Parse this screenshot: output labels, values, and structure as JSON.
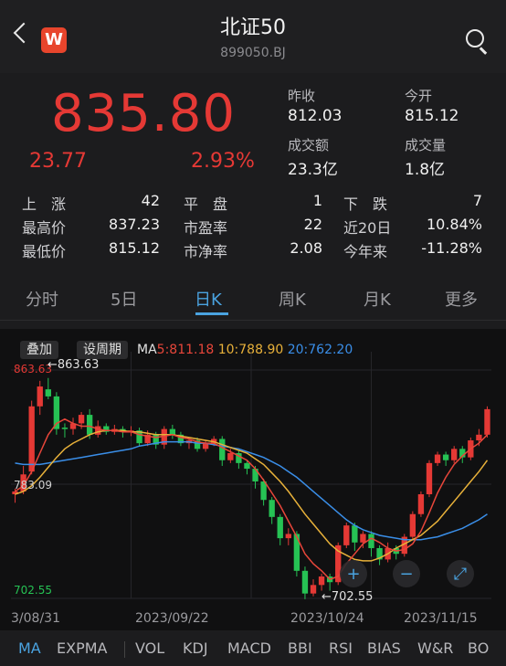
{
  "header": {
    "title": "北证50",
    "code": "899050.BJ",
    "logo": "W"
  },
  "quote": {
    "price": "835.80",
    "change": "23.77",
    "change_pct": "2.93%",
    "prev_close_label": "昨收",
    "prev_close": "812.03",
    "open_label": "今开",
    "open": "815.12",
    "turnover_label": "成交额",
    "turnover": "23.3亿",
    "volume_label": "成交量",
    "volume": "1.8亿",
    "rise_label": "上　涨",
    "rise": "42",
    "flat_label": "平　盘",
    "flat": "1",
    "fall_label": "下　跌",
    "fall": "7",
    "high_label": "最高价",
    "high": "837.23",
    "pe_label": "市盈率",
    "pe": "22",
    "d20_label": "近20日",
    "d20": "10.84%",
    "low_label": "最低价",
    "low": "815.12",
    "pb_label": "市净率",
    "pb": "2.08",
    "ytd_label": "今年来",
    "ytd": "-11.28%"
  },
  "tabs": [
    "分时",
    "5日",
    "日K",
    "周K",
    "月K",
    "更多"
  ],
  "active_tab": "日K",
  "chart_toolbar": {
    "overlay": "叠加",
    "period": "设周期",
    "ma_prefix": "MA",
    "ma5": "5:811.18",
    "ma10": "10:788.90",
    "ma20": "20:762.20"
  },
  "chart_data": {
    "type": "candlestick",
    "y_top_label": "863.63",
    "y_mid_label": "783.09",
    "y_bot_label": "702.55",
    "max_marker": "863.63",
    "min_marker": "702.55",
    "ylim": [
      702.55,
      863.63
    ],
    "x_labels": [
      "3/08/31",
      "2023/09/22",
      "2023/10/24",
      "2023/11/15"
    ],
    "colors": {
      "up": "#e53935",
      "down": "#26c254",
      "ma5": "#e8463a",
      "ma10": "#e8b13a",
      "ma20": "#3a8ee8"
    },
    "candles": [
      [
        776,
        778,
        770,
        780
      ],
      [
        778,
        790,
        776,
        796
      ],
      [
        792,
        838,
        790,
        842
      ],
      [
        838,
        852,
        832,
        856
      ],
      [
        850,
        845,
        843,
        858
      ],
      [
        845,
        822,
        818,
        848
      ],
      [
        823,
        822,
        816,
        826
      ],
      [
        822,
        826,
        818,
        830
      ],
      [
        826,
        832,
        822,
        834
      ],
      [
        832,
        818,
        815,
        836
      ],
      [
        818,
        824,
        816,
        828
      ],
      [
        824,
        820,
        818,
        826
      ],
      [
        820,
        822,
        818,
        825
      ],
      [
        822,
        820,
        816,
        824
      ],
      [
        820,
        821,
        817,
        824
      ],
      [
        821,
        812,
        810,
        823
      ],
      [
        812,
        818,
        810,
        821
      ],
      [
        818,
        811,
        808,
        820
      ],
      [
        811,
        822,
        808,
        824
      ],
      [
        822,
        818,
        815,
        825
      ],
      [
        818,
        812,
        810,
        820
      ],
      [
        812,
        814,
        808,
        816
      ],
      [
        814,
        808,
        806,
        816
      ],
      [
        808,
        812,
        806,
        814
      ],
      [
        812,
        815,
        810,
        817
      ],
      [
        815,
        800,
        796,
        817
      ],
      [
        800,
        805,
        798,
        808
      ],
      [
        805,
        798,
        794,
        807
      ],
      [
        798,
        794,
        790,
        800
      ],
      [
        794,
        785,
        780,
        796
      ],
      [
        785,
        772,
        768,
        787
      ],
      [
        772,
        760,
        755,
        774
      ],
      [
        760,
        745,
        740,
        762
      ],
      [
        745,
        748,
        740,
        752
      ],
      [
        748,
        722,
        718,
        750
      ],
      [
        722,
        706,
        702,
        725
      ],
      [
        706,
        712,
        704,
        716
      ],
      [
        712,
        718,
        708,
        720
      ],
      [
        718,
        714,
        708,
        720
      ],
      [
        714,
        740,
        712,
        742
      ],
      [
        740,
        754,
        738,
        756
      ],
      [
        754,
        742,
        736,
        756
      ],
      [
        742,
        748,
        738,
        750
      ],
      [
        748,
        738,
        732,
        750
      ],
      [
        738,
        730,
        726,
        740
      ],
      [
        730,
        738,
        728,
        742
      ],
      [
        738,
        734,
        730,
        740
      ],
      [
        734,
        746,
        732,
        748
      ],
      [
        746,
        762,
        744,
        764
      ],
      [
        762,
        776,
        760,
        778
      ],
      [
        776,
        798,
        774,
        800
      ],
      [
        798,
        804,
        796,
        806
      ],
      [
        804,
        800,
        796,
        806
      ],
      [
        800,
        808,
        798,
        810
      ],
      [
        808,
        802,
        798,
        810
      ],
      [
        802,
        814,
        800,
        816
      ],
      [
        814,
        818,
        810,
        822
      ],
      [
        818,
        836,
        816,
        838
      ]
    ],
    "ma5": [
      778,
      782,
      792,
      805,
      818,
      826,
      829,
      826,
      824,
      824,
      822,
      821,
      821,
      820,
      820,
      818,
      817,
      816,
      817,
      818,
      816,
      815,
      813,
      812,
      812,
      809,
      806,
      803,
      800,
      794,
      786,
      777,
      768,
      757,
      746,
      734,
      727,
      722,
      716,
      718,
      727,
      734,
      741,
      745,
      742,
      738,
      736,
      737,
      741,
      750,
      763,
      777,
      788,
      797,
      803,
      808,
      812,
      818
    ],
    "ma10": [
      776,
      778,
      782,
      788,
      795,
      802,
      808,
      812,
      815,
      818,
      820,
      821,
      821,
      821,
      820,
      820,
      819,
      818,
      818,
      818,
      817,
      816,
      815,
      814,
      813,
      811,
      809,
      807,
      805,
      801,
      797,
      791,
      785,
      778,
      770,
      762,
      755,
      748,
      741,
      736,
      733,
      730,
      729,
      729,
      731,
      734,
      738,
      741,
      744,
      747,
      752,
      757,
      764,
      771,
      778,
      785,
      792,
      800
    ],
    "ma20": [
      798,
      797,
      797,
      797,
      798,
      799,
      800,
      801,
      802,
      803,
      804,
      805,
      806,
      807,
      808,
      810,
      811,
      812,
      813,
      813,
      813,
      813,
      812,
      812,
      811,
      810,
      809,
      808,
      806,
      804,
      802,
      799,
      796,
      792,
      788,
      783,
      778,
      773,
      768,
      763,
      758,
      754,
      751,
      749,
      747,
      746,
      745,
      744,
      744,
      744,
      745,
      746,
      748,
      750,
      752,
      755,
      758,
      762
    ]
  },
  "indicators": [
    "MA",
    "EXPMA",
    "VOL",
    "KDJ",
    "MACD",
    "BBI",
    "RSI",
    "BIAS",
    "W&R",
    "BO"
  ]
}
